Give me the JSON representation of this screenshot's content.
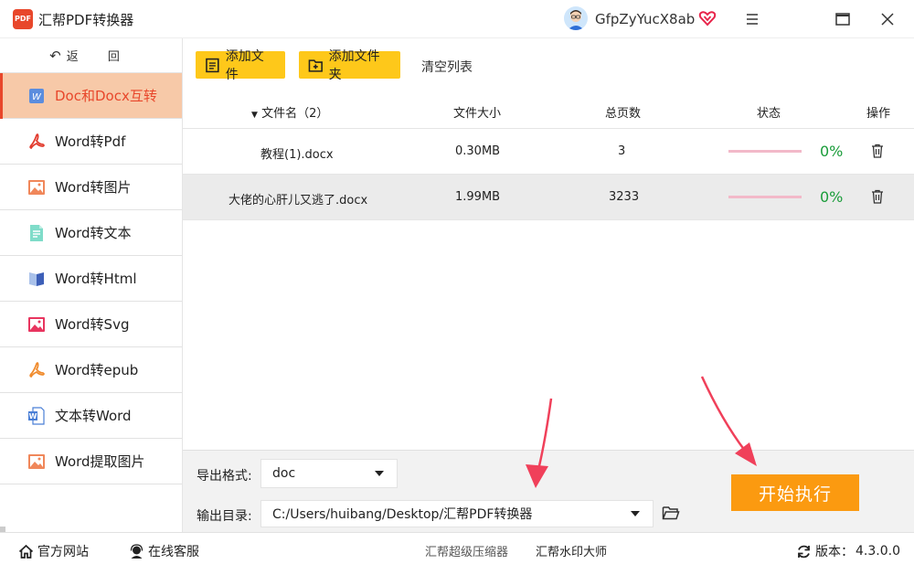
{
  "app": {
    "title": "汇帮PDF转换器",
    "logo_text": "PDF",
    "username": "GfpZyYucX8ab"
  },
  "sidebar": {
    "back_label": "返 回",
    "items": [
      {
        "label": "Doc和Docx互转",
        "icon": "word-doc-icon",
        "active": true
      },
      {
        "label": "Word转Pdf",
        "icon": "pdf-icon"
      },
      {
        "label": "Word转图片",
        "icon": "image-icon"
      },
      {
        "label": "Word转文本",
        "icon": "text-file-icon"
      },
      {
        "label": "Word转Html",
        "icon": "html-book-icon"
      },
      {
        "label": "Word转Svg",
        "icon": "svg-image-icon"
      },
      {
        "label": "Word转epub",
        "icon": "epub-icon"
      },
      {
        "label": "文本转Word",
        "icon": "word-icon"
      },
      {
        "label": "Word提取图片",
        "icon": "extract-image-icon"
      }
    ]
  },
  "toolbar": {
    "add_file": "添加文件",
    "add_folder": "添加文件夹",
    "clear_list": "清空列表"
  },
  "table": {
    "headers": {
      "name": "文件名（2）",
      "size": "文件大小",
      "pages": "总页数",
      "status": "状态",
      "action": "操作"
    },
    "rows": [
      {
        "name": "教程(1).docx",
        "size": "0.30MB",
        "pages": "3",
        "progress": "0%"
      },
      {
        "name": "大佬的心肝儿又逃了.docx",
        "size": "1.99MB",
        "pages": "3233",
        "progress": "0%"
      }
    ]
  },
  "bottom": {
    "format_label": "导出格式:",
    "format_value": "doc",
    "dir_label": "输出目录:",
    "dir_value": "C:/Users/huibang/Desktop/汇帮PDF转换器",
    "start_label": "开始执行"
  },
  "statusbar": {
    "website": "官方网站",
    "support": "在线客服",
    "compressor": "汇帮超级压缩器",
    "watermark": "汇帮水印大师",
    "version_label": "版本：",
    "version_value": "4.3.0.0"
  },
  "colors": {
    "accent": "#e8472b",
    "active_bg": "#f7c9a8",
    "button_yellow": "#fec81a",
    "start_orange": "#fb9a10",
    "progress_green": "#1a9c3a",
    "arrow_red": "#f0405a"
  }
}
